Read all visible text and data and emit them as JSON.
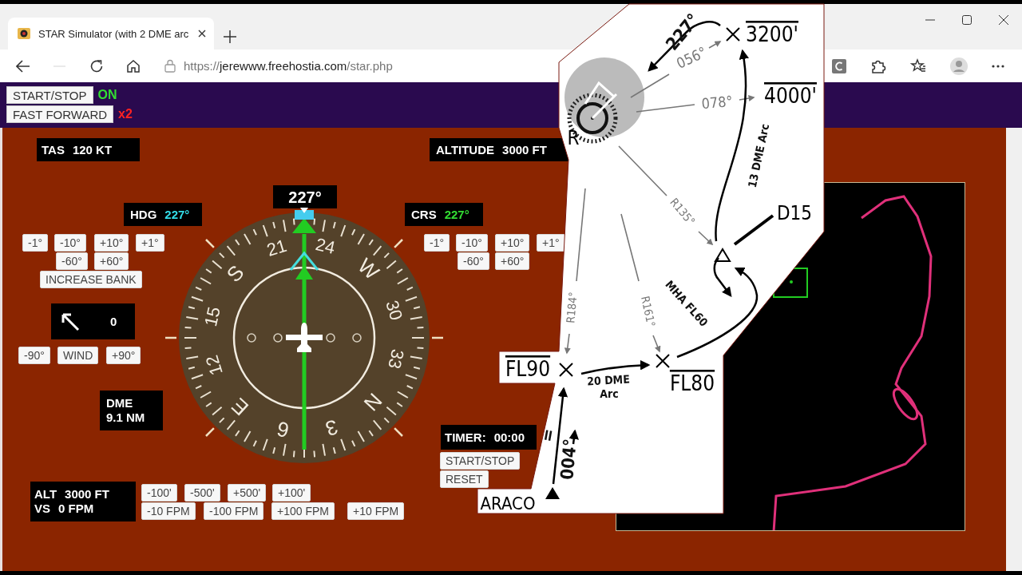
{
  "browser": {
    "tab_title": "STAR Simulator (with 2 DME arc",
    "url_scheme": "https://",
    "url_host": "jerewww.freehostia.com",
    "url_path": "/star.php"
  },
  "top_controls": [
    {
      "label": "START/STOP",
      "status": "ON",
      "kind": "on"
    },
    {
      "label": "FAST FORWARD",
      "status": "x2",
      "kind": "speed"
    }
  ],
  "tas": {
    "label": "TAS",
    "value": "120 KT"
  },
  "altitude": {
    "label": "ALTITUDE",
    "value": "3000 FT"
  },
  "hdg": {
    "label": "HDG",
    "value": "227°",
    "buttons": [
      [
        "-1°",
        "-10°",
        "+10°",
        "+1°"
      ],
      [
        "-60°",
        "+60°"
      ],
      [
        "INCREASE BANK"
      ]
    ]
  },
  "crs": {
    "label": "CRS",
    "value": "227°",
    "buttons": [
      [
        "-1°",
        "-10°",
        "+10°",
        "+1°"
      ],
      [
        "-60°",
        "+60°"
      ]
    ]
  },
  "wind": {
    "value": "0",
    "buttons": [
      "-90°",
      "WIND",
      "+90°"
    ]
  },
  "hsi": {
    "heading_readout": "227°",
    "card_labels": [
      "N",
      "3",
      "6",
      "E",
      "12",
      "15",
      "S",
      "21",
      "24",
      "W",
      "30",
      "33"
    ]
  },
  "dme": {
    "label": "DME",
    "value": "9.1 NM"
  },
  "timer": {
    "label": "TIMER:",
    "value": "00:00",
    "buttons": [
      "START/STOP",
      "RESET"
    ]
  },
  "alt_vs": {
    "alt_label": "ALT",
    "alt_value": "3000 FT",
    "vs_label": "VS",
    "vs_value": "0 FPM",
    "buttons": [
      [
        "-100'",
        "-500'",
        "+500'",
        "+100'"
      ],
      [
        "-10 FPM",
        "-100 FPM",
        "+100 FPM",
        "+10 FPM"
      ]
    ]
  },
  "chart": {
    "labels": [
      {
        "text": "227°",
        "kind": "course"
      },
      {
        "text": "056°",
        "kind": "radial"
      },
      {
        "text": "3200'",
        "kind": "altitude"
      },
      {
        "text": "078°",
        "kind": "radial"
      },
      {
        "text": "4000'",
        "kind": "altitude"
      },
      {
        "text": "13 DME Arc",
        "kind": "arc"
      },
      {
        "text": "R135°",
        "kind": "radial"
      },
      {
        "text": "D15",
        "kind": "fix"
      },
      {
        "text": "MHA FL60",
        "kind": "arc"
      },
      {
        "text": "R184°",
        "kind": "radial"
      },
      {
        "text": "R161°",
        "kind": "radial"
      },
      {
        "text": "FL90",
        "kind": "altitude"
      },
      {
        "text": "20 DME",
        "kind": "arc"
      },
      {
        "text": "Arc",
        "kind": "arc"
      },
      {
        "text": "FL80",
        "kind": "altitude"
      },
      {
        "text": "ARACO",
        "kind": "fix"
      },
      {
        "text": "004°",
        "kind": "course"
      },
      {
        "text": "=",
        "kind": "course"
      },
      {
        "text": "R",
        "kind": "fix"
      }
    ]
  }
}
